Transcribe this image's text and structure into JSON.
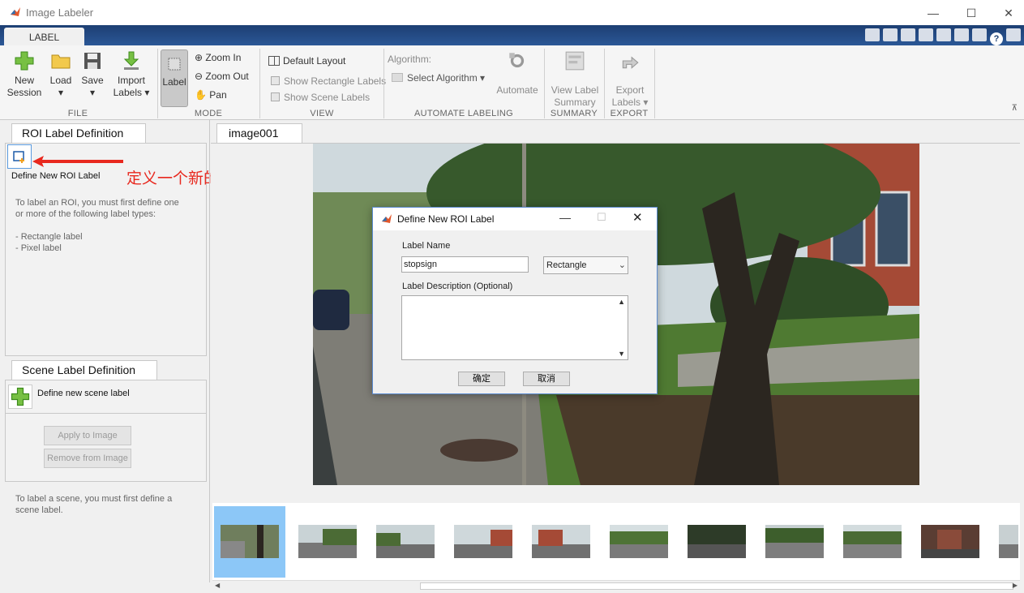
{
  "window": {
    "title": "Image Labeler",
    "controls": [
      "—",
      "☐",
      "✕"
    ]
  },
  "ribbon_tab": "LABEL",
  "file": {
    "group_label": "FILE",
    "new_session": [
      "New",
      "Session"
    ],
    "load": "Load",
    "save": "Save",
    "import_labels": [
      "Import",
      "Labels"
    ]
  },
  "mode": {
    "group_label": "MODE",
    "label_button": "Label",
    "zoom_in": "Zoom In",
    "zoom_out": "Zoom Out",
    "pan": "Pan"
  },
  "view": {
    "group_label": "VIEW",
    "default_layout": "Default Layout",
    "show_rect_labels": "Show Rectangle Labels",
    "show_scene_labels": "Show Scene Labels"
  },
  "automate": {
    "group_label": "AUTOMATE LABELING",
    "algorithm_label": "Algorithm:",
    "select_algorithm": "Select Algorithm",
    "automate_button": "Automate"
  },
  "summary": {
    "group_label": "SUMMARY",
    "view_label_summary": [
      "View Label",
      "Summary"
    ]
  },
  "export": {
    "group_label": "EXPORT",
    "export_labels": [
      "Export",
      "Labels"
    ]
  },
  "roi_panel": {
    "tab": "ROI Label Definition",
    "define_new": "Define New ROI Label",
    "annotation": "定义一个新的ROI(Region of Interest标签)",
    "help_line1": "To label an ROI, you must first define one",
    "help_line2": "or more of the following label types:",
    "type1": "- Rectangle label",
    "type2": "- Pixel label"
  },
  "scene_panel": {
    "tab": "Scene Label Definition",
    "define_new": "Define new scene label",
    "apply": "Apply to Image",
    "remove": "Remove from Image",
    "help_line1": "To label a scene, you must first define a",
    "help_line2": "scene label."
  },
  "image_tab": "image001",
  "dialog": {
    "title": "Define New ROI Label",
    "label_name_caption": "Label Name",
    "label_name_value": "stopsign",
    "type_value": "Rectangle",
    "description_caption": "Label Description (Optional)",
    "ok": "确定",
    "cancel": "取消"
  },
  "filmstrip": {
    "count": 10,
    "selected_index": 0
  },
  "colors": {
    "ribbon_blue": "#2b5796",
    "annotation_red": "#e8281e",
    "selection_blue": "#8cc7f7"
  }
}
